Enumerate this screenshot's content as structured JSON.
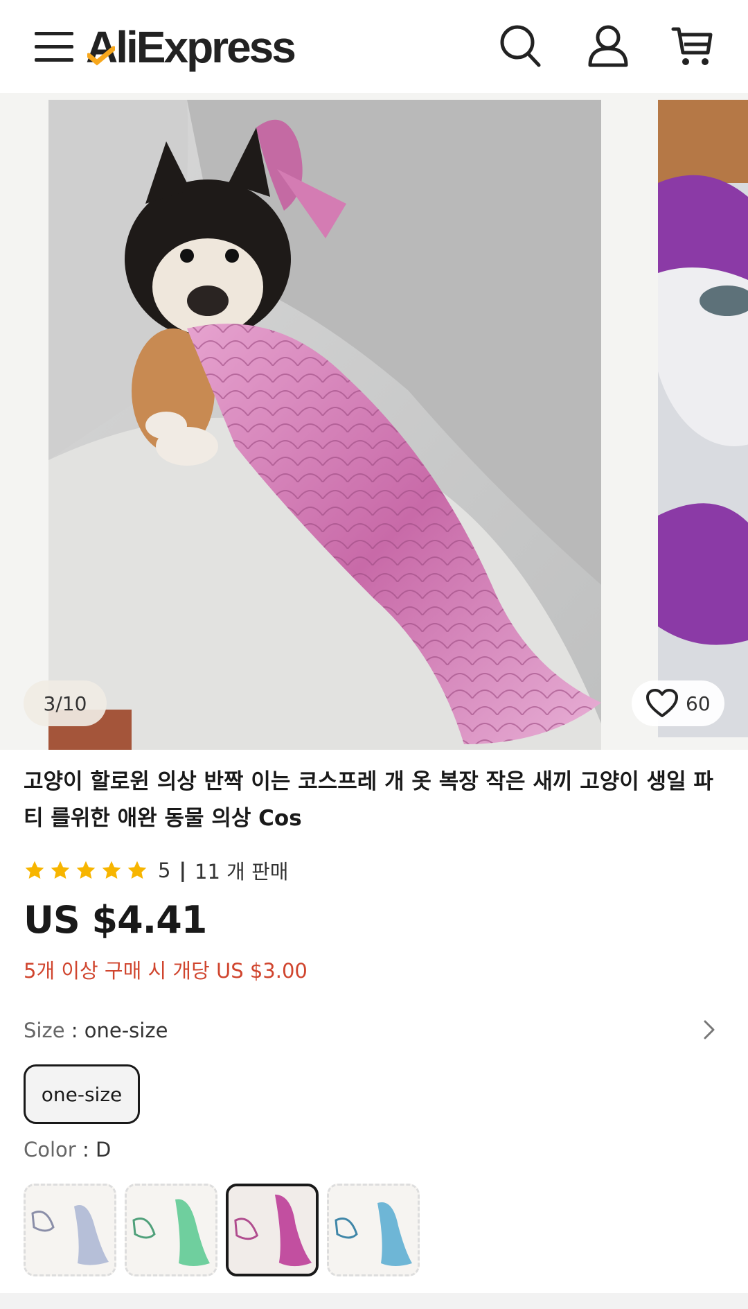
{
  "header": {
    "logo_text": "AliExpress",
    "icons": [
      "menu-icon",
      "search-icon",
      "user-icon",
      "cart-icon"
    ]
  },
  "gallery": {
    "counter": "3/10",
    "wishlist_count": "60"
  },
  "product": {
    "title": "고양이 할로윈 의상 반짝 이는 코스프레 개 옷 복장 작은 새끼 고양이 생일 파티 를위한 애완 동물 의상 Cos",
    "rating": "5",
    "sold": "11 개 판매",
    "price": "US $4.41",
    "bulk_price": "5개 이상 구매 시 개당 US $3.00"
  },
  "size": {
    "label": "Size",
    "value": "one-size",
    "option": "one-size"
  },
  "color": {
    "label": "Color",
    "value": "D",
    "swatches": [
      "silver",
      "green",
      "pink",
      "blue"
    ],
    "selected_index": 2
  },
  "colors": {
    "accent_red": "#d0452e",
    "star": "#f7b500",
    "logo_orange": "#f7a71c"
  }
}
